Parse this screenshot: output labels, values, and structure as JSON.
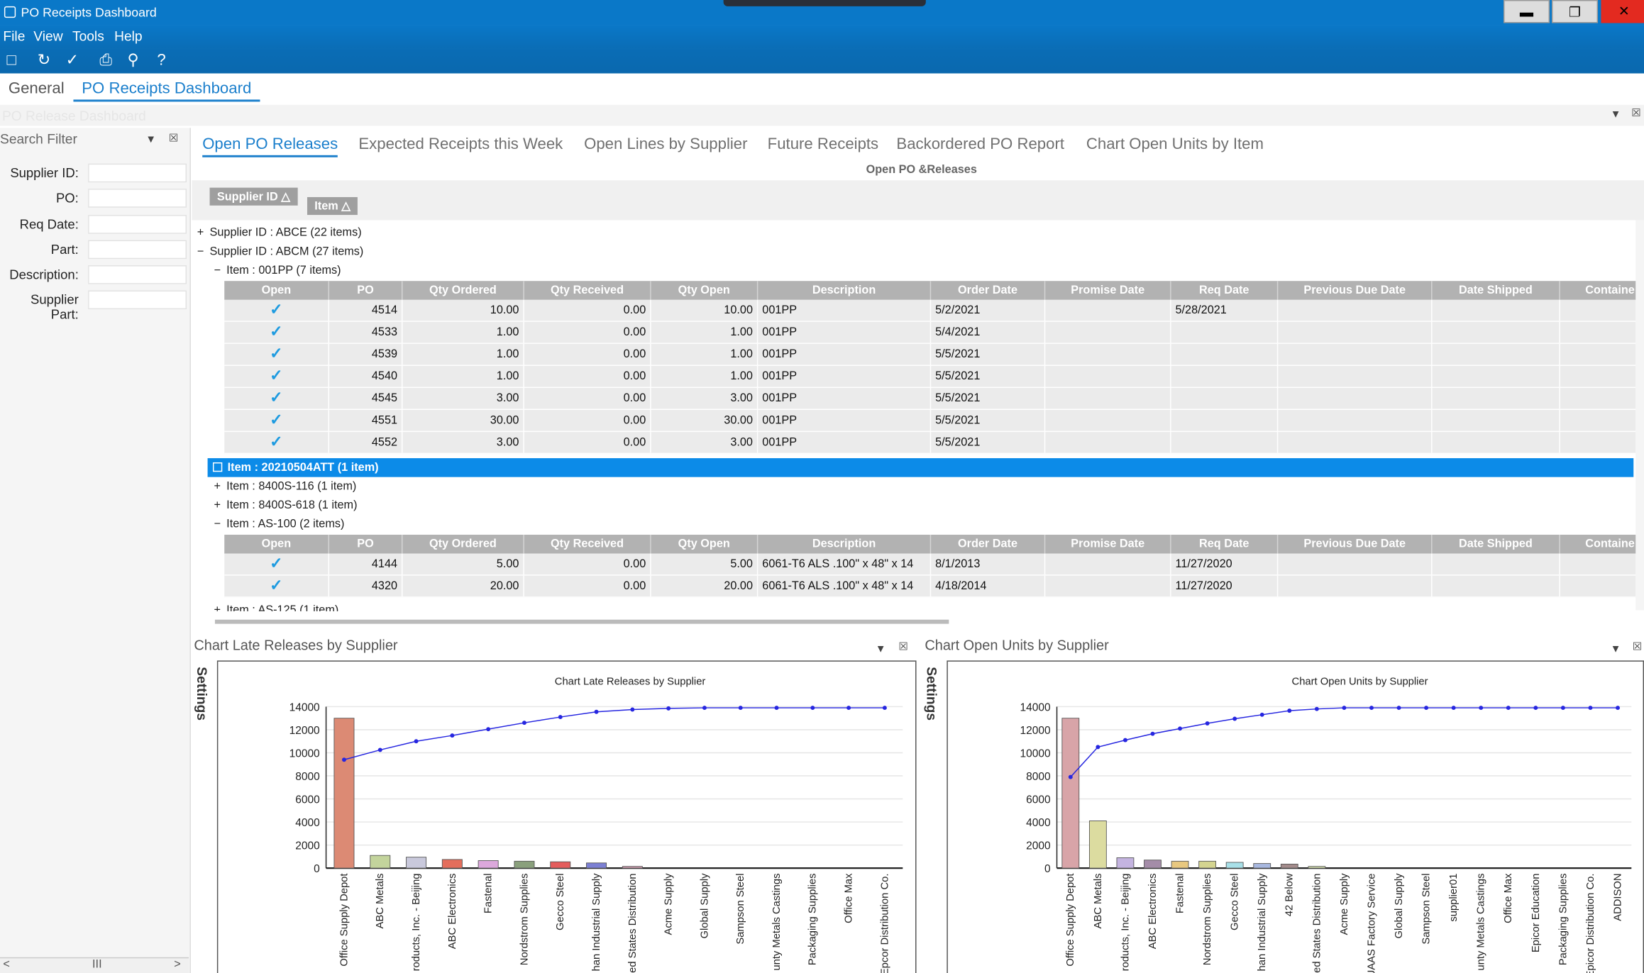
{
  "window": {
    "title": "PO Receipts Dashboard"
  },
  "menu": [
    "File",
    "View",
    "Tools",
    "Help"
  ],
  "main_tabs": [
    {
      "label": "General"
    },
    {
      "label": "PO Receipts Dashboard"
    }
  ],
  "section_title": "PO Release Dashboard",
  "search": {
    "header": "Search Filter",
    "fields": [
      {
        "label": "Supplier ID:"
      },
      {
        "label": "PO:"
      },
      {
        "label": "Req Date:"
      },
      {
        "label": "Part:"
      },
      {
        "label": "Description:"
      },
      {
        "label": "Supplier Part:"
      }
    ]
  },
  "sub_tabs": [
    {
      "label": "Open PO Releases"
    },
    {
      "label": "Expected Receipts this Week"
    },
    {
      "label": "Open Lines by Supplier"
    },
    {
      "label": "Future Receipts"
    },
    {
      "label": "Backordered PO Report"
    },
    {
      "label": "Chart Open Units by Item"
    }
  ],
  "grid": {
    "caption": "Open PO &Releases",
    "group_chips": [
      "Supplier ID",
      "Item"
    ],
    "groups": [
      "Supplier ID : ABCE (22 items)",
      "Supplier ID : ABCM (27 items)",
      "Item : 001PP (7 items)",
      "Item : 20210504ATT (1 item)",
      "Item : 8400S-116 (1 item)",
      "Item : 8400S-618 (1 item)",
      "Item : AS-100 (2 items)",
      "Item : AS-125 (1 item)"
    ],
    "columns": [
      "Open",
      "PO",
      "Qty Ordered",
      "Qty Received",
      "Qty Open",
      "Description",
      "Order Date",
      "Promise Date",
      "Req Date",
      "Previous Due Date",
      "Date Shipped",
      "Containe"
    ],
    "rows_001pp": [
      {
        "po": "4514",
        "qty_ordered": "10.00",
        "qty_received": "0.00",
        "qty_open": "10.00",
        "description": "001PP",
        "order_date": "5/2/2021",
        "req_date": "5/28/2021"
      },
      {
        "po": "4533",
        "qty_ordered": "1.00",
        "qty_received": "0.00",
        "qty_open": "1.00",
        "description": "001PP",
        "order_date": "5/4/2021",
        "req_date": ""
      },
      {
        "po": "4539",
        "qty_ordered": "1.00",
        "qty_received": "0.00",
        "qty_open": "1.00",
        "description": "001PP",
        "order_date": "5/5/2021",
        "req_date": ""
      },
      {
        "po": "4540",
        "qty_ordered": "1.00",
        "qty_received": "0.00",
        "qty_open": "1.00",
        "description": "001PP",
        "order_date": "5/5/2021",
        "req_date": ""
      },
      {
        "po": "4545",
        "qty_ordered": "3.00",
        "qty_received": "0.00",
        "qty_open": "3.00",
        "description": "001PP",
        "order_date": "5/5/2021",
        "req_date": ""
      },
      {
        "po": "4551",
        "qty_ordered": "30.00",
        "qty_received": "0.00",
        "qty_open": "30.00",
        "description": "001PP",
        "order_date": "5/5/2021",
        "req_date": ""
      },
      {
        "po": "4552",
        "qty_ordered": "3.00",
        "qty_received": "0.00",
        "qty_open": "3.00",
        "description": "001PP",
        "order_date": "5/5/2021",
        "req_date": ""
      }
    ],
    "rows_as100": [
      {
        "po": "4144",
        "qty_ordered": "5.00",
        "qty_received": "0.00",
        "qty_open": "5.00",
        "description": "6061-T6 ALS .100\" x 48\" x 14",
        "order_date": "8/1/2013",
        "req_date": "11/27/2020"
      },
      {
        "po": "4320",
        "qty_ordered": "20.00",
        "qty_received": "0.00",
        "qty_open": "20.00",
        "description": "6061-T6 ALS .100\" x 48\" x 14",
        "order_date": "4/18/2014",
        "req_date": "11/27/2020"
      }
    ]
  },
  "panels": {
    "left_title": "Chart Late Releases by Supplier",
    "right_title": "Chart Open Units by Supplier",
    "settings": "Settings"
  },
  "chart_data": [
    {
      "type": "bar",
      "title": "Chart Late Releases by Supplier",
      "ylim": [
        0,
        14000
      ],
      "yticks": [
        0,
        2000,
        4000,
        6000,
        8000,
        10000,
        12000,
        14000
      ],
      "categories": [
        "Office Supply Depot",
        "ABC Metals",
        "roducts, Inc. - Beijing",
        "ABC Electronics",
        "Fastenal",
        "Nordstrom Supplies",
        "Gecco Steel",
        "han Industrial Supply",
        "ed States Distribution",
        "Acme Supply",
        "Global Supply",
        "Sampson Steel",
        "unty Metals Castings",
        "Packaging Supplies",
        "Office Max",
        "Epcor Distribution Co."
      ],
      "values": [
        13000,
        1100,
        950,
        750,
        650,
        600,
        550,
        450,
        150,
        0,
        0,
        0,
        0,
        0,
        0,
        0
      ],
      "colors": [
        "#dc8a74",
        "#c3d49c",
        "#c9c9dc",
        "#e46e5c",
        "#dca8dc",
        "#8aa07c",
        "#e45c5c",
        "#7c80d4",
        "#d4a0b4",
        "#ffffff",
        "#ffffff",
        "#ffffff",
        "#ffffff",
        "#ffffff",
        "#ffffff",
        "#ffffff"
      ],
      "cumulative": [
        9400,
        10250,
        11000,
        11500,
        12050,
        12600,
        13100,
        13550,
        13750,
        13850,
        13900,
        13900,
        13900,
        13900,
        13900,
        13900
      ],
      "line_color": "#2626e0"
    },
    {
      "type": "bar",
      "title": "Chart Open Units by Supplier",
      "ylim": [
        0,
        14000
      ],
      "yticks": [
        0,
        2000,
        4000,
        6000,
        8000,
        10000,
        12000,
        14000
      ],
      "categories": [
        "Office Supply Depot",
        "ABC Metals",
        "roducts, Inc. - Beijing",
        "ABC Electronics",
        "Fastenal",
        "Nordstrom Supplies",
        "Gecco Steel",
        "han Industrial Supply",
        "42 Below",
        "ed States Distribution",
        "Acme Supply",
        "UAAS Factory Service",
        "Global Supply",
        "Sampson Steel",
        "supplier01",
        "unty Metals Castings",
        "Office Max",
        "Epicor Education",
        "Packaging Supplies",
        "Epicor Distribution Co.",
        "ADDISON"
      ],
      "values": [
        13000,
        4100,
        900,
        700,
        600,
        600,
        500,
        400,
        350,
        150,
        0,
        0,
        0,
        0,
        0,
        0,
        0,
        0,
        0,
        0,
        0
      ],
      "colors": [
        "#d8a4a8",
        "#dcdca0",
        "#c4b4e0",
        "#a48ca8",
        "#e8c880",
        "#d4d490",
        "#a8e0e8",
        "#a8b8e0",
        "#a48c8c",
        "#d8e4b0",
        "#ffffff",
        "#ffffff",
        "#ffffff",
        "#ffffff",
        "#ffffff",
        "#ffffff",
        "#ffffff",
        "#ffffff",
        "#ffffff",
        "#ffffff",
        "#ffffff"
      ],
      "cumulative": [
        7900,
        10500,
        11100,
        11650,
        12100,
        12550,
        12950,
        13300,
        13650,
        13800,
        13900,
        13900,
        13900,
        13900,
        13900,
        13900,
        13900,
        13900,
        13900,
        13900,
        13900
      ],
      "line_color": "#2626e0"
    }
  ],
  "scroll_label": "III"
}
